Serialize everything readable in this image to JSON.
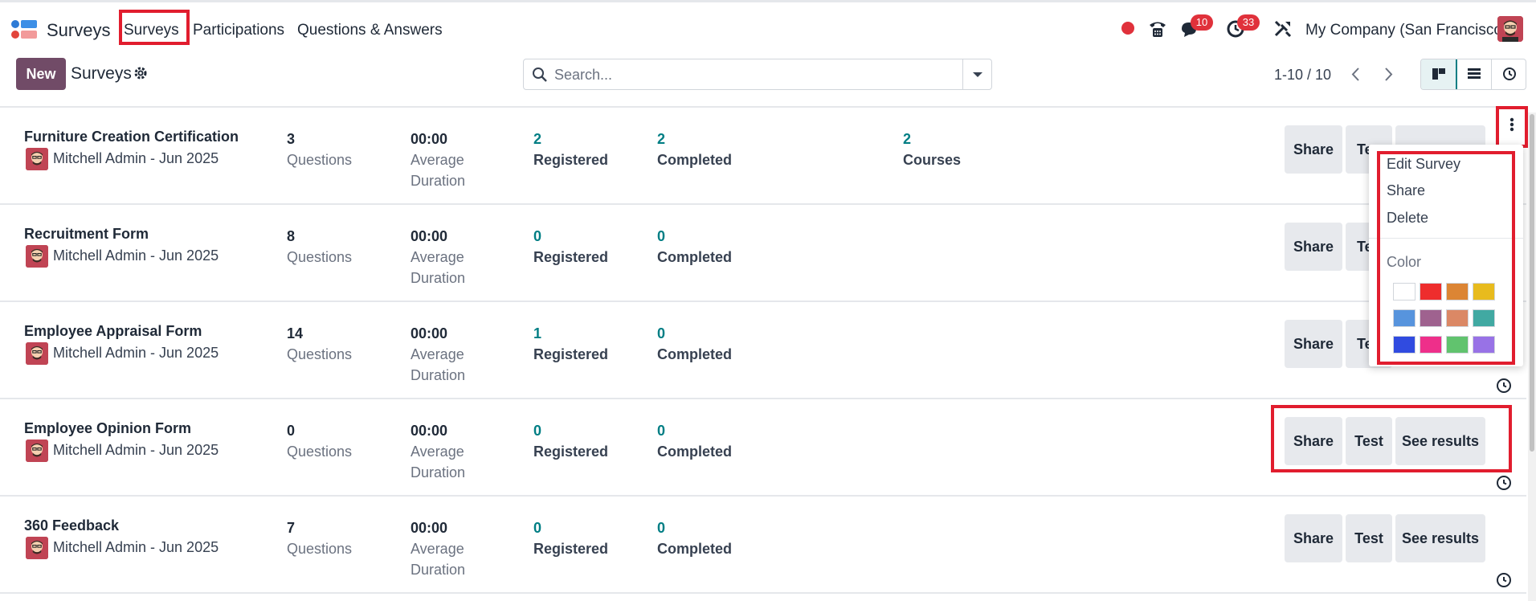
{
  "app": {
    "name": "Surveys",
    "menu": [
      "Surveys",
      "Participations",
      "Questions & Answers"
    ],
    "badges": {
      "messages": "10",
      "activities": "33"
    },
    "company": "My Company (San Francisco)"
  },
  "control": {
    "new_label": "New",
    "breadcrumb": "Surveys",
    "search_placeholder": "Search...",
    "pager": "1-10 / 10"
  },
  "rows": [
    {
      "title": "Furniture Creation Certification",
      "owner": "Mitchell Admin - Jun 2025",
      "questions": "3",
      "duration": "00:00",
      "registered": "2",
      "completed": "2",
      "courses": "2"
    },
    {
      "title": "Recruitment Form",
      "owner": "Mitchell Admin - Jun 2025",
      "questions": "8",
      "duration": "00:00",
      "registered": "0",
      "completed": "0"
    },
    {
      "title": "Employee Appraisal Form",
      "owner": "Mitchell Admin - Jun 2025",
      "questions": "14",
      "duration": "00:00",
      "registered": "1",
      "completed": "0"
    },
    {
      "title": "Employee Opinion Form",
      "owner": "Mitchell Admin - Jun 2025",
      "questions": "0",
      "duration": "00:00",
      "registered": "0",
      "completed": "0"
    },
    {
      "title": "360 Feedback",
      "owner": "Mitchell Admin - Jun 2025",
      "questions": "7",
      "duration": "00:00",
      "registered": "0",
      "completed": "0"
    }
  ],
  "labels": {
    "questions": "Questions",
    "avg": "Average",
    "duration": "Duration",
    "registered": "Registered",
    "completed": "Completed",
    "courses": "Courses"
  },
  "buttons": {
    "share": "Share",
    "test": "Test",
    "see_results": "See results",
    "test_partial": "Te"
  },
  "dropdown": {
    "items": [
      "Edit Survey",
      "Share",
      "Delete"
    ],
    "color_label": "Color",
    "colors": [
      "#ffffff",
      "#ee2d2d",
      "#dc8534",
      "#e8bb1d",
      "#5794dd",
      "#9f628f",
      "#db8865",
      "#41a9a2",
      "#304be0",
      "#ee2f8a",
      "#61c36e",
      "#9872e6"
    ]
  }
}
